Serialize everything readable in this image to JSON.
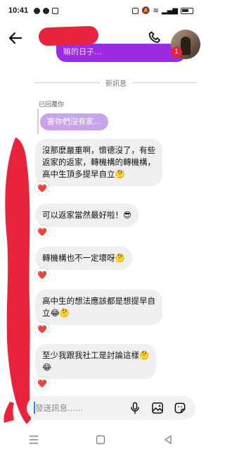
{
  "status_bar": {
    "time": "10:41"
  },
  "header": {
    "unread_count": "1"
  },
  "previous_message": {
    "text": "嘛的日子..."
  },
  "divider": {
    "label": "新訊息"
  },
  "reply": {
    "label": "已回覆你",
    "quoted_text": "害你們沒有家..."
  },
  "messages": [
    {
      "line1": "沒那麼嚴重啊，懷德沒了，有些",
      "line2": "返家的返家，轉機構的轉機構，",
      "line3": "高中生頂多提早自立🤔",
      "reaction": "❤️"
    },
    {
      "line1": "可以返家當然最好啦！😎",
      "reaction": "❤️"
    },
    {
      "line1": "轉機構也不一定壞呀🤔",
      "reaction": "❤️"
    },
    {
      "line1": "高中生的想法應該都是想提早自",
      "line2": "立😂🤔",
      "reaction": "❤️"
    },
    {
      "line1": "至少我跟我社工是討論這樣🤔",
      "line2": "😂",
      "reaction": "❤️"
    }
  ],
  "composer": {
    "placeholder": "發送訊息......"
  },
  "colors": {
    "accent": "#9b2ce0",
    "redaction": "#e8243c",
    "bubble": "#efefef"
  },
  "icons": [
    "back-arrow-icon",
    "phone-icon",
    "microphone-icon",
    "gallery-icon",
    "sticker-icon"
  ]
}
